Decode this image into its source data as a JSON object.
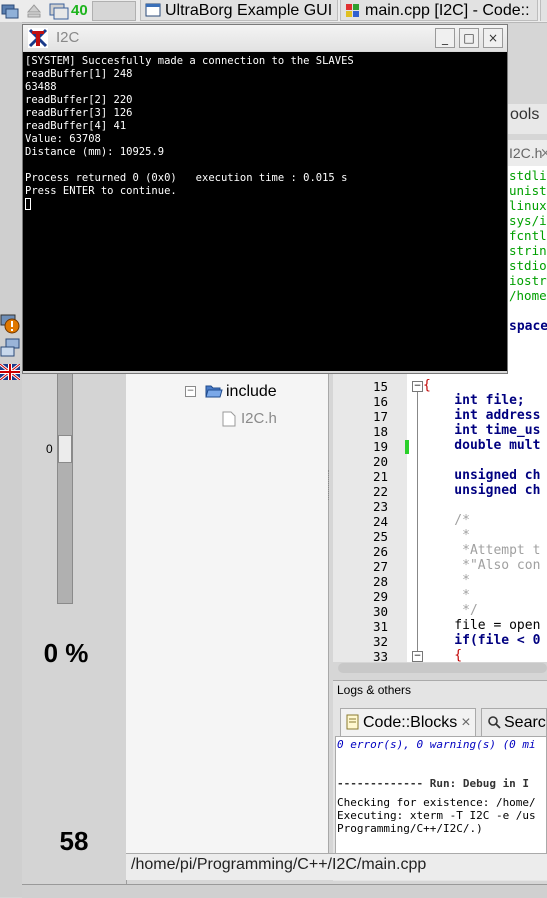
{
  "taskbar": {
    "workspace_number": "40",
    "tasks": [
      {
        "label": "UltraBorg Example GUI"
      },
      {
        "label": "main.cpp [I2C] - Code::"
      }
    ]
  },
  "terminal": {
    "title": "I2C",
    "lines": [
      "[SYSTEM] Succesfully made a connection to the SLAVES",
      "readBuffer[1] 248",
      "63488",
      "readBuffer[2] 220",
      "readBuffer[3] 126",
      "readBuffer[4] 41",
      "Value: 63708",
      "Distance (mm): 10925.9",
      "",
      "Process returned 0 (0x0)   execution time : 0.015 s",
      "Press ENTER to continue."
    ]
  },
  "ultraborg": {
    "slider_label": "0",
    "slider_value": 0,
    "percent": "0 %",
    "distance_value": "58"
  },
  "project_tree": {
    "folder": "include",
    "file": "I2C.h"
  },
  "editor": {
    "tab_fragment": "I2C.h",
    "toolbar_fragment": "ools",
    "include_fragments": [
      "stdli",
      "unist",
      "linux",
      "sys/i",
      "fcntl",
      "strin",
      "stdio",
      "iostr",
      "/home"
    ],
    "namespace_fragment": "space",
    "line_numbers": [
      "15",
      "16",
      "17",
      "18",
      "19",
      "20",
      "21",
      "22",
      "23",
      "24",
      "25",
      "26",
      "27",
      "28",
      "29",
      "30",
      "31",
      "32",
      "33"
    ],
    "code_lines": [
      "{",
      "    int file;",
      "    int address",
      "    int time_us",
      "    double mult",
      "",
      "    unsigned ch",
      "    unsigned ch",
      "",
      "    /*",
      "     *",
      "     *Attempt t",
      "     *\"Also con",
      "     *",
      "     *",
      "     */",
      "    file = open",
      "    if(file < 0",
      "    {"
    ]
  },
  "logs": {
    "panel_title": "Logs & others",
    "tabs": [
      "Code::Blocks",
      "Searc"
    ],
    "summary": "0 error(s), 0 warning(s) (0 mi",
    "run_header": "------------- Run: Debug in I",
    "lines": [
      "Checking for existence: /home/",
      "Executing: xterm -T I2C -e /us",
      "Programming/C++/I2C/.)"
    ]
  },
  "statusbar": {
    "path": "/home/pi/Programming/C++/I2C/main.cpp"
  },
  "colors": {
    "terminal_bg": "#000000",
    "terminal_fg": "#ffffff",
    "include_green": "#00a000",
    "keyword_navy": "#000080",
    "comment_gray": "#a0a0a0",
    "number_red": "#c00000"
  }
}
